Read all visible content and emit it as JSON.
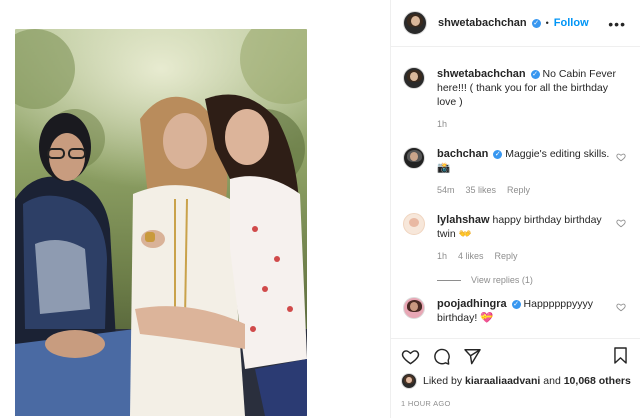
{
  "post": {
    "author": "shwetabachchan",
    "follow_label": "Follow",
    "separator": "•",
    "more": "•••"
  },
  "caption": {
    "user": "shwetabachchan",
    "text": "No Cabin Fever here!!! ( thank you for all the birthday love )",
    "age": "1h"
  },
  "comments": [
    {
      "user": "bachchan",
      "verified": true,
      "text": "Maggie's editing skills. 📸",
      "age": "54m",
      "likes": "35 likes",
      "reply": "Reply"
    },
    {
      "user": "lylahshaw",
      "verified": false,
      "text": "happy birthday birthday twin 👐",
      "age": "1h",
      "likes": "4 likes",
      "reply": "Reply"
    },
    {
      "user": "poojadhingra",
      "verified": true,
      "text": "Happppppyyyy birthday! 💝",
      "age": "",
      "likes": "",
      "reply": ""
    }
  ],
  "view_replies": "View replies (1)",
  "likes_line": {
    "prefix": "Liked by",
    "user": "kiaraaliaadvani",
    "joiner": "and",
    "others": "10,068 others"
  },
  "timestamp": "1 HOUR AGO",
  "colors": {
    "accent": "#0095f6",
    "verified": "#3897f0",
    "muted": "#8e8e8e",
    "border": "#efefef"
  },
  "icons": [
    "heart-icon",
    "comment-icon",
    "share-icon",
    "bookmark-icon",
    "more-icon",
    "verified-icon"
  ]
}
